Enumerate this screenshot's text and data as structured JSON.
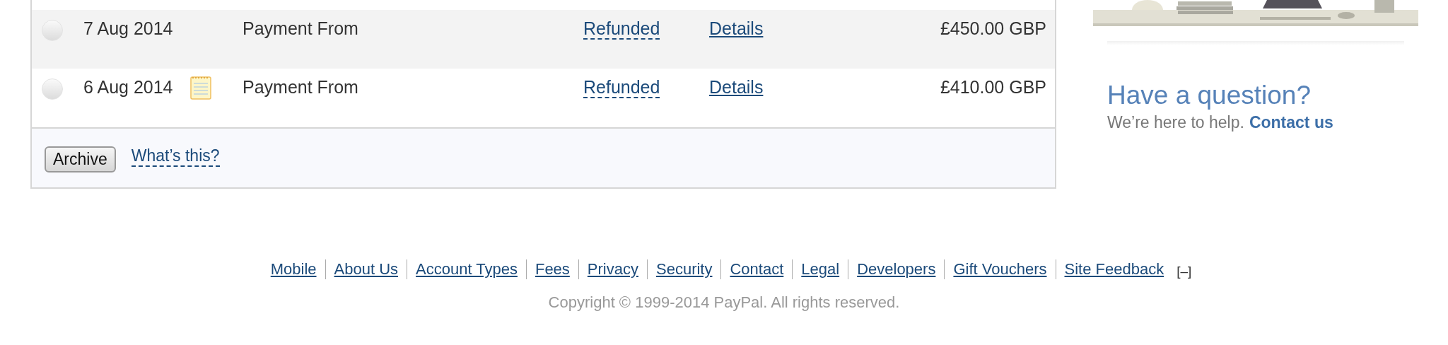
{
  "transactions": [
    {
      "selected": false,
      "date": "7 Aug 2014",
      "note": false,
      "description": "Payment From",
      "status": "Refunded",
      "details": "Details",
      "amount": "£450.00 GBP"
    },
    {
      "selected": false,
      "date": "6 Aug 2014",
      "note": true,
      "description": "Payment From",
      "status": "Refunded",
      "details": "Details",
      "amount": "£410.00 GBP"
    }
  ],
  "table_footer": {
    "button": "Archive",
    "help_link": "What’s this?"
  },
  "help_box": {
    "title": "Have a question?",
    "text": "We’re here to help.",
    "link": "Contact us"
  },
  "footer": {
    "links": [
      "Mobile",
      "About Us",
      "Account Types",
      "Fees",
      "Privacy",
      "Security",
      "Contact",
      "Legal",
      "Developers",
      "Gift Vouchers",
      "Site Feedback"
    ],
    "toggle": "[–]",
    "copyright": "Copyright © 1999-2014 PayPal. All rights reserved."
  }
}
